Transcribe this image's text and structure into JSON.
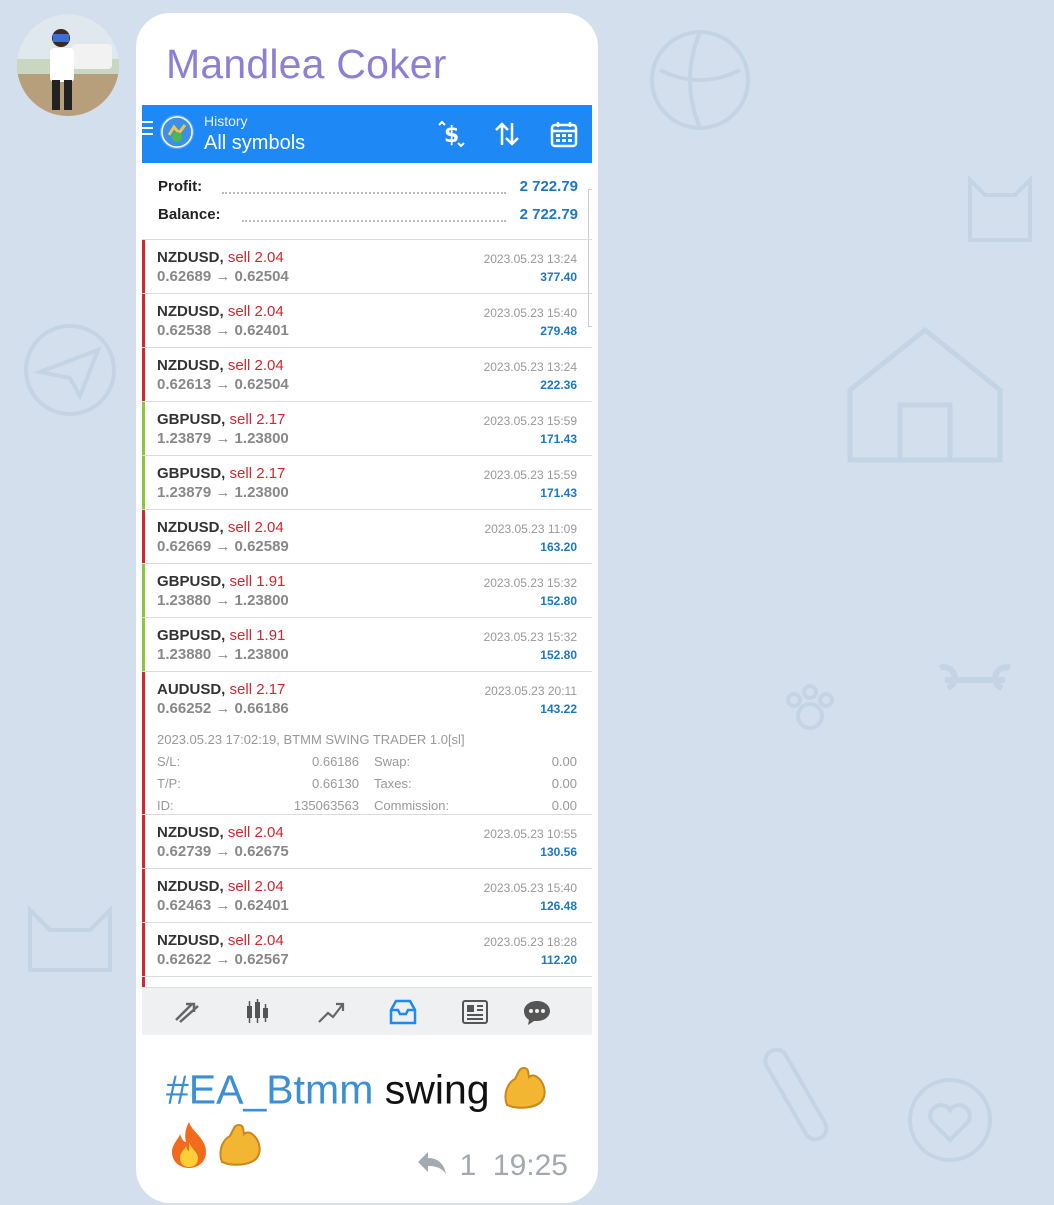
{
  "message": {
    "sender": "Mandlea Coker",
    "caption_hashtag": "#EA_Btmm",
    "caption_text": " swing ",
    "reply_count": "1",
    "time": "19:25"
  },
  "terminal": {
    "header_subtitle": "History",
    "header_title": "All symbols",
    "summary": {
      "profit_label": "Profit:",
      "profit_value": "2 722.79",
      "balance_label": "Balance:",
      "balance_value": "2 722.79"
    },
    "deals": [
      {
        "symbol": "NZDUSD,",
        "side": "sell 2.04",
        "prices": "0.62689 → 0.62504",
        "time": "2023.05.23 13:24",
        "profit": "377.40",
        "bar": "#d3262e"
      },
      {
        "symbol": "NZDUSD,",
        "side": "sell 2.04",
        "prices": "0.62538 → 0.62401",
        "time": "2023.05.23 15:40",
        "profit": "279.48",
        "bar": "#d3262e"
      },
      {
        "symbol": "NZDUSD,",
        "side": "sell 2.04",
        "prices": "0.62613 → 0.62504",
        "time": "2023.05.23 13:24",
        "profit": "222.36",
        "bar": "#d3262e"
      },
      {
        "symbol": "GBPUSD,",
        "side": "sell 2.17",
        "prices": "1.23879 → 1.23800",
        "time": "2023.05.23 15:59",
        "profit": "171.43",
        "bar": "#8cc63f"
      },
      {
        "symbol": "GBPUSD,",
        "side": "sell 2.17",
        "prices": "1.23879 → 1.23800",
        "time": "2023.05.23 15:59",
        "profit": "171.43",
        "bar": "#8cc63f"
      },
      {
        "symbol": "NZDUSD,",
        "side": "sell 2.04",
        "prices": "0.62669 → 0.62589",
        "time": "2023.05.23 11:09",
        "profit": "163.20",
        "bar": "#d3262e"
      },
      {
        "symbol": "GBPUSD,",
        "side": "sell 1.91",
        "prices": "1.23880 → 1.23800",
        "time": "2023.05.23 15:32",
        "profit": "152.80",
        "bar": "#8cc63f"
      },
      {
        "symbol": "GBPUSD,",
        "side": "sell 1.91",
        "prices": "1.23880 → 1.23800",
        "time": "2023.05.23 15:32",
        "profit": "152.80",
        "bar": "#8cc63f"
      },
      {
        "symbol": "AUDUSD,",
        "side": "sell 2.17",
        "prices": "0.66252 → 0.66186",
        "time": "2023.05.23 20:11",
        "profit": "143.22",
        "bar": "#d3262e",
        "expanded": true,
        "detail": "2023.05.23 17:02:19, BTMM SWING TRADER 1.0[sl]",
        "sl_label": "S/L:",
        "sl_value": "0.66186",
        "tp_label": "T/P:",
        "tp_value": "0.66130",
        "id_label": "ID:",
        "id_value": "135063563",
        "swap_label": "Swap:",
        "swap_value": "0.00",
        "taxes_label": "Taxes:",
        "taxes_value": "0.00",
        "commission_label": "Commission:",
        "commission_value": "0.00"
      },
      {
        "symbol": "NZDUSD,",
        "side": "sell 2.04",
        "prices": "0.62739 → 0.62675",
        "time": "2023.05.23 10:55",
        "profit": "130.56",
        "bar": "#d3262e"
      },
      {
        "symbol": "NZDUSD,",
        "side": "sell 2.04",
        "prices": "0.62463 → 0.62401",
        "time": "2023.05.23 15:40",
        "profit": "126.48",
        "bar": "#d3262e"
      },
      {
        "symbol": "NZDUSD,",
        "side": "sell 2.04",
        "prices": "0.62622 → 0.62567",
        "time": "2023.05.23 18:28",
        "profit": "112.20",
        "bar": "#d3262e"
      }
    ],
    "nav_icons": [
      "quotes-icon",
      "chart-icon",
      "trade-icon",
      "history-icon",
      "news-icon",
      "messages-icon"
    ],
    "active_nav": "history-icon",
    "accent_color": "#1e88f5"
  }
}
